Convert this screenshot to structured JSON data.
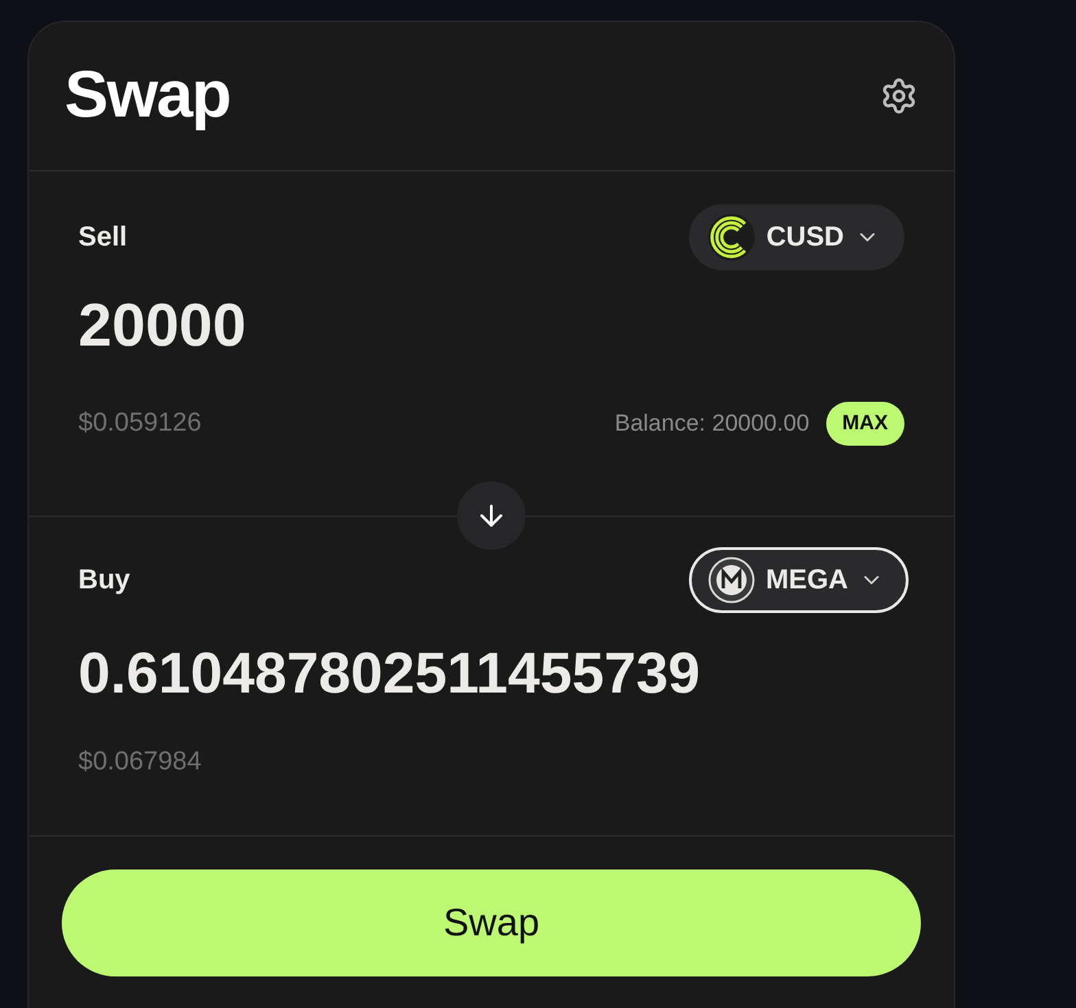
{
  "title": "Swap",
  "sell": {
    "label": "Sell",
    "token": {
      "symbol": "CUSD",
      "selected": false
    },
    "amount": "20000",
    "usd": "$0.059126",
    "balance": "Balance: 20000.00",
    "max": "MAX"
  },
  "buy": {
    "label": "Buy",
    "token": {
      "symbol": "MEGA",
      "selected": true
    },
    "amount": "0.610487802511455739",
    "usd": "$0.067984"
  },
  "swap_button": "Swap"
}
